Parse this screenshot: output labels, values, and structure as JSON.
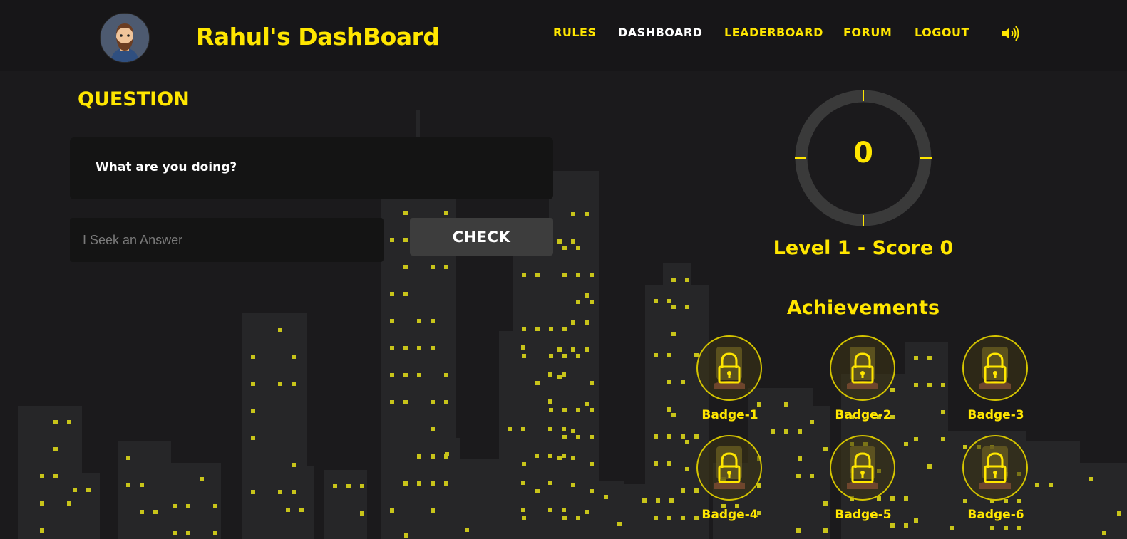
{
  "header": {
    "title": "Rahul's DashBoard",
    "nav": [
      "RULES",
      "DASHBOARD",
      "LEADERBOARD",
      "FORUM",
      "LOGOUT"
    ],
    "active_nav": "DASHBOARD",
    "sound_icon": "speaker-icon",
    "avatar_icon": "bearded-man-avatar-icon"
  },
  "question": {
    "heading": "QUESTION",
    "text": "What are you doing?",
    "answer_placeholder": "I Seek an Answer",
    "answer_value": "",
    "check_label": "CHECK"
  },
  "stats": {
    "timer_value": "0",
    "level_score": "Level 1 - Score 0"
  },
  "achievements": {
    "title": "Achievements",
    "badges": [
      {
        "label": "Badge-1",
        "icon": "lock-icon",
        "locked": true
      },
      {
        "label": "Badge-2",
        "icon": "lock-icon",
        "locked": true
      },
      {
        "label": "Badge-3",
        "icon": "lock-icon",
        "locked": true
      },
      {
        "label": "Badge-4",
        "icon": "lock-icon",
        "locked": true
      },
      {
        "label": "Badge-5",
        "icon": "lock-icon",
        "locked": true
      },
      {
        "label": "Badge-6",
        "icon": "lock-icon",
        "locked": true
      }
    ]
  },
  "colors": {
    "accent": "#ffe600",
    "background": "#1b1a1c",
    "header": "#171618",
    "panel": "#141414",
    "button": "#3d3d3d",
    "building": "#262628",
    "window_light": "#c8c41a"
  },
  "background": "city-skyline-illustration"
}
